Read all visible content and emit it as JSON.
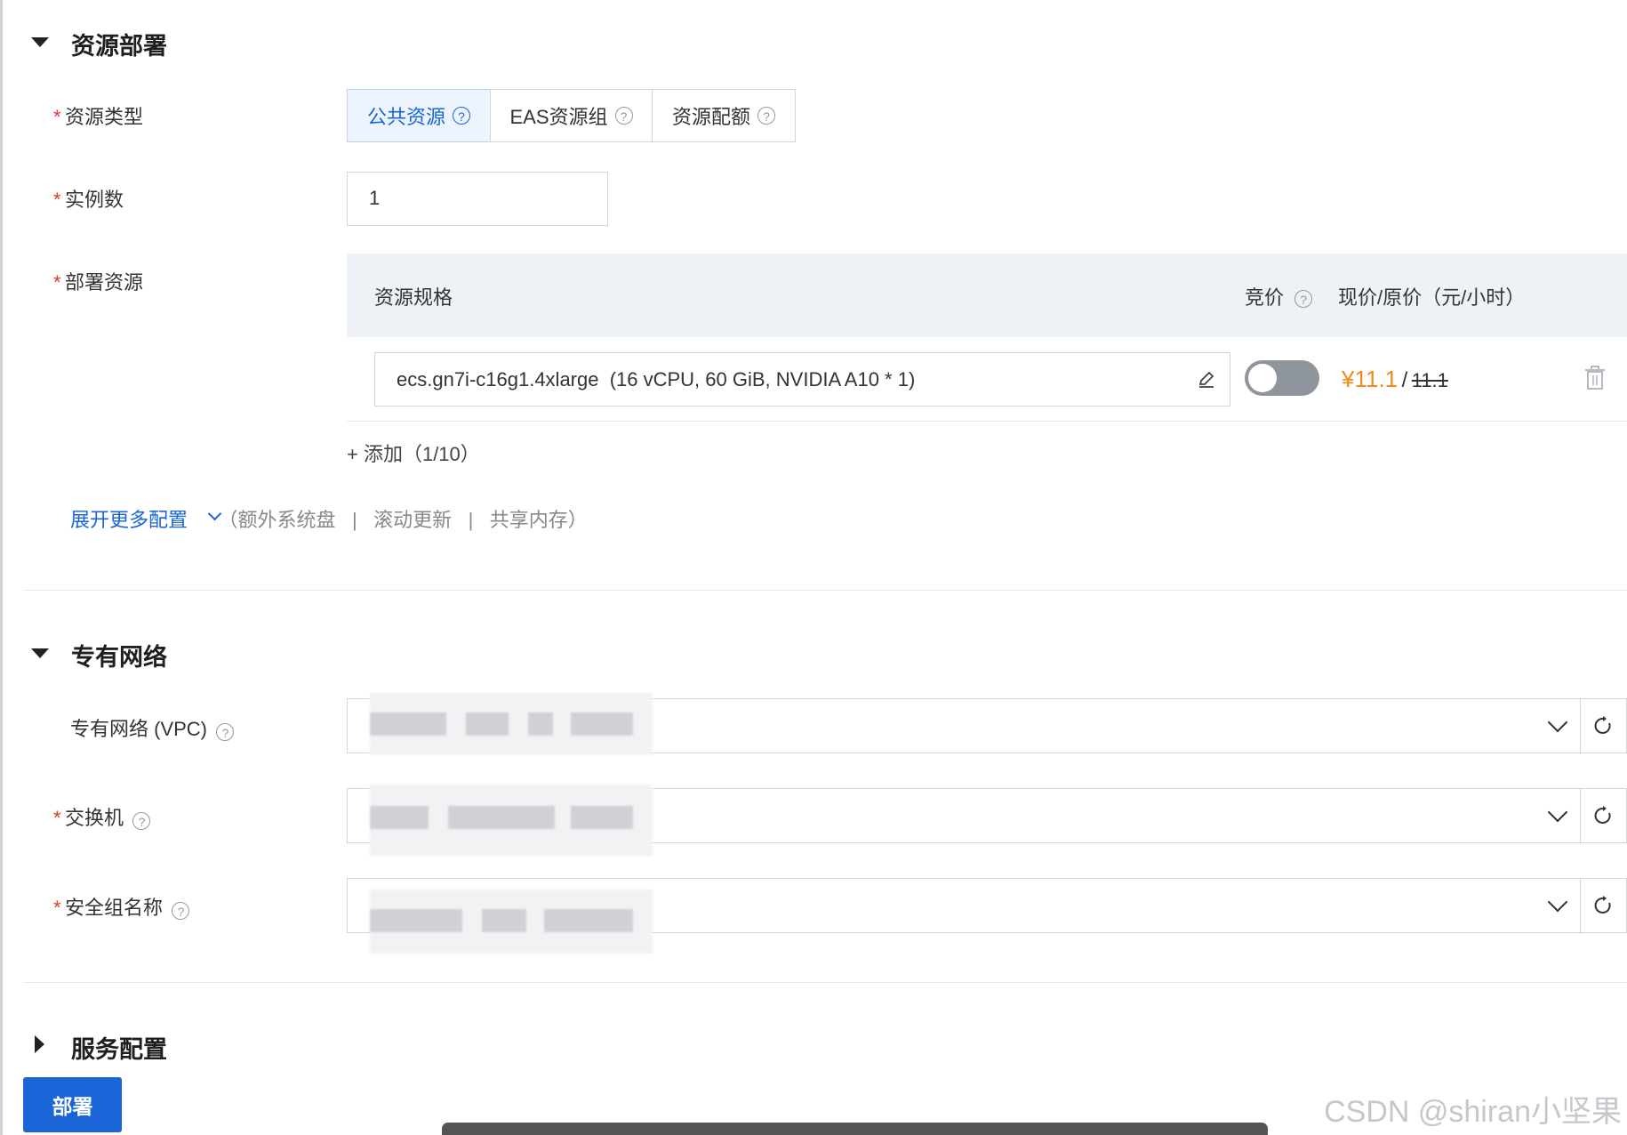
{
  "sections": {
    "resource": {
      "title": "资源部署"
    },
    "network": {
      "title": "专有网络"
    },
    "service": {
      "title": "服务配置"
    }
  },
  "resource_type": {
    "label": "资源类型",
    "options": [
      "公共资源",
      "EAS资源组",
      "资源配额"
    ],
    "selected": "公共资源"
  },
  "instances": {
    "label": "实例数",
    "value": "1"
  },
  "deploy_resource": {
    "label": "部署资源",
    "headers": {
      "spec": "资源规格",
      "bid": "竞价",
      "price": "现价/原价（元/小时）"
    },
    "row": {
      "spec": "ecs.gn7i-c16g1.4xlarge  (16 vCPU, 60 GiB, NVIDIA A10 * 1)",
      "bid_enabled": false,
      "price_now": "¥11.1",
      "price_sep": "/",
      "price_old": "11.1"
    },
    "add": "+ 添加（1/10）"
  },
  "more_config": {
    "link": "展开更多配置",
    "open": "（额外系统盘",
    "item1": "滚动更新",
    "item2": "共享内存）",
    "sep": "|"
  },
  "network_fields": {
    "vpc": {
      "label": "专有网络 (VPC)"
    },
    "switch": {
      "label": "交换机"
    },
    "security_group": {
      "label": "安全组名称"
    }
  },
  "required_mark": "*",
  "help_glyph": "?",
  "deploy_button": "部署",
  "watermark": "CSDN @shiran小坚果",
  "colors": {
    "accent": "#1a66d8",
    "price": "#f28b1c",
    "required": "#e0362c"
  }
}
